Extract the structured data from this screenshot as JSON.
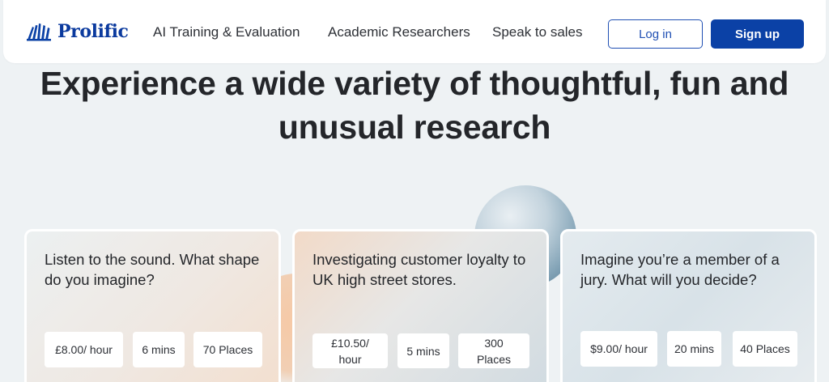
{
  "header": {
    "logo_text": "Prolific",
    "nav": [
      {
        "label": "AI Training & Evaluation"
      },
      {
        "label": "Academic Researchers"
      },
      {
        "label": "Speak to sales"
      }
    ],
    "login_label": "Log in",
    "signup_label": "Sign up",
    "brand_color": "#0b41a6"
  },
  "hero": {
    "title_line1": "Experience a wide variety of thoughtful, fun and",
    "title_line2": "unusual research"
  },
  "cards": [
    {
      "title": "Listen to the sound. What shape do you imagine?",
      "rate": "£8.00/ hour",
      "duration": "6 mins",
      "places": "70 Places"
    },
    {
      "title": "Investigating customer loyalty to UK high street stores.",
      "rate_line1": "£10.50/",
      "rate_line2": "hour",
      "duration": "5 mins",
      "places_line1": "300",
      "places_line2": "Places"
    },
    {
      "title": "Imagine you’re a member of a jury. What will you decide?",
      "rate": "$9.00/ hour",
      "duration": "20 mins",
      "places": "40 Places"
    }
  ]
}
